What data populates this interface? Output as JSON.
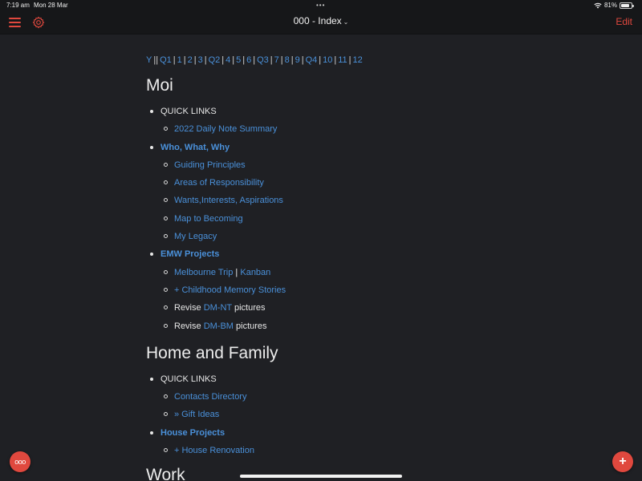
{
  "status_bar": {
    "time": "7:19 am",
    "date": "Mon 28 Mar",
    "multitask_dots": "•••",
    "battery_percent": "81%",
    "battery_level": 0.81
  },
  "toolbar": {
    "title": "000 - Index",
    "title_chevron": "⌄",
    "edit_label": "Edit",
    "menu_icon": "hamburger-icon",
    "settings_icon": "gear-icon",
    "accent_color": "#e0483e"
  },
  "nav_links": [
    "Y",
    "Q1",
    "1",
    "2",
    "3",
    "Q2",
    "4",
    "5",
    "6",
    "Q3",
    "7",
    "8",
    "9",
    "Q4",
    "10",
    "11",
    "12"
  ],
  "nav_separators": {
    "after_Y": "||",
    "default": "|"
  },
  "sections": [
    {
      "heading": "Moi",
      "items": [
        {
          "text": "QUICK LINKS",
          "type": "plain",
          "children": [
            {
              "parts": [
                {
                  "text": "2022 Daily Note Summary",
                  "link": true
                }
              ]
            }
          ]
        },
        {
          "text": "Who, What, Why",
          "type": "link",
          "children": [
            {
              "parts": [
                {
                  "text": "Guiding Principles",
                  "link": true
                }
              ]
            },
            {
              "parts": [
                {
                  "text": "Areas of Responsibility",
                  "link": true
                }
              ]
            },
            {
              "parts": [
                {
                  "text": "Wants,Interests, Aspirations",
                  "link": true
                }
              ]
            },
            {
              "parts": [
                {
                  "text": "Map to Becoming",
                  "link": true
                }
              ]
            },
            {
              "parts": [
                {
                  "text": "My Legacy",
                  "link": true
                }
              ]
            }
          ]
        },
        {
          "text": "EMW Projects",
          "type": "link",
          "children": [
            {
              "parts": [
                {
                  "text": "Melbourne Trip",
                  "link": true
                },
                {
                  "text": " | ",
                  "link": false
                },
                {
                  "text": "Kanban",
                  "link": true
                }
              ]
            },
            {
              "parts": [
                {
                  "text": "+ Childhood Memory Stories",
                  "link": true
                }
              ]
            },
            {
              "parts": [
                {
                  "text": "Revise ",
                  "link": false
                },
                {
                  "text": "DM-NT",
                  "link": true
                },
                {
                  "text": " pictures",
                  "link": false
                }
              ]
            },
            {
              "parts": [
                {
                  "text": "Revise ",
                  "link": false
                },
                {
                  "text": "DM-BM",
                  "link": true
                },
                {
                  "text": " pictures",
                  "link": false
                }
              ]
            }
          ]
        }
      ]
    },
    {
      "heading": "Home and Family",
      "items": [
        {
          "text": "QUICK LINKS",
          "type": "plain",
          "children": [
            {
              "parts": [
                {
                  "text": "Contacts Directory",
                  "link": true
                }
              ]
            },
            {
              "parts": [
                {
                  "text": "» Gift Ideas",
                  "link": true
                }
              ]
            }
          ]
        },
        {
          "text": "House Projects",
          "type": "link",
          "children": [
            {
              "parts": [
                {
                  "text": "+ House Renovation",
                  "link": true
                }
              ]
            }
          ]
        }
      ]
    }
  ],
  "next_heading": "Work",
  "fab": {
    "more_label": "ooo",
    "add_label": "+"
  },
  "colors": {
    "link": "#4a90d9",
    "background": "#1f2024",
    "toolbar_bg": "#161719"
  }
}
